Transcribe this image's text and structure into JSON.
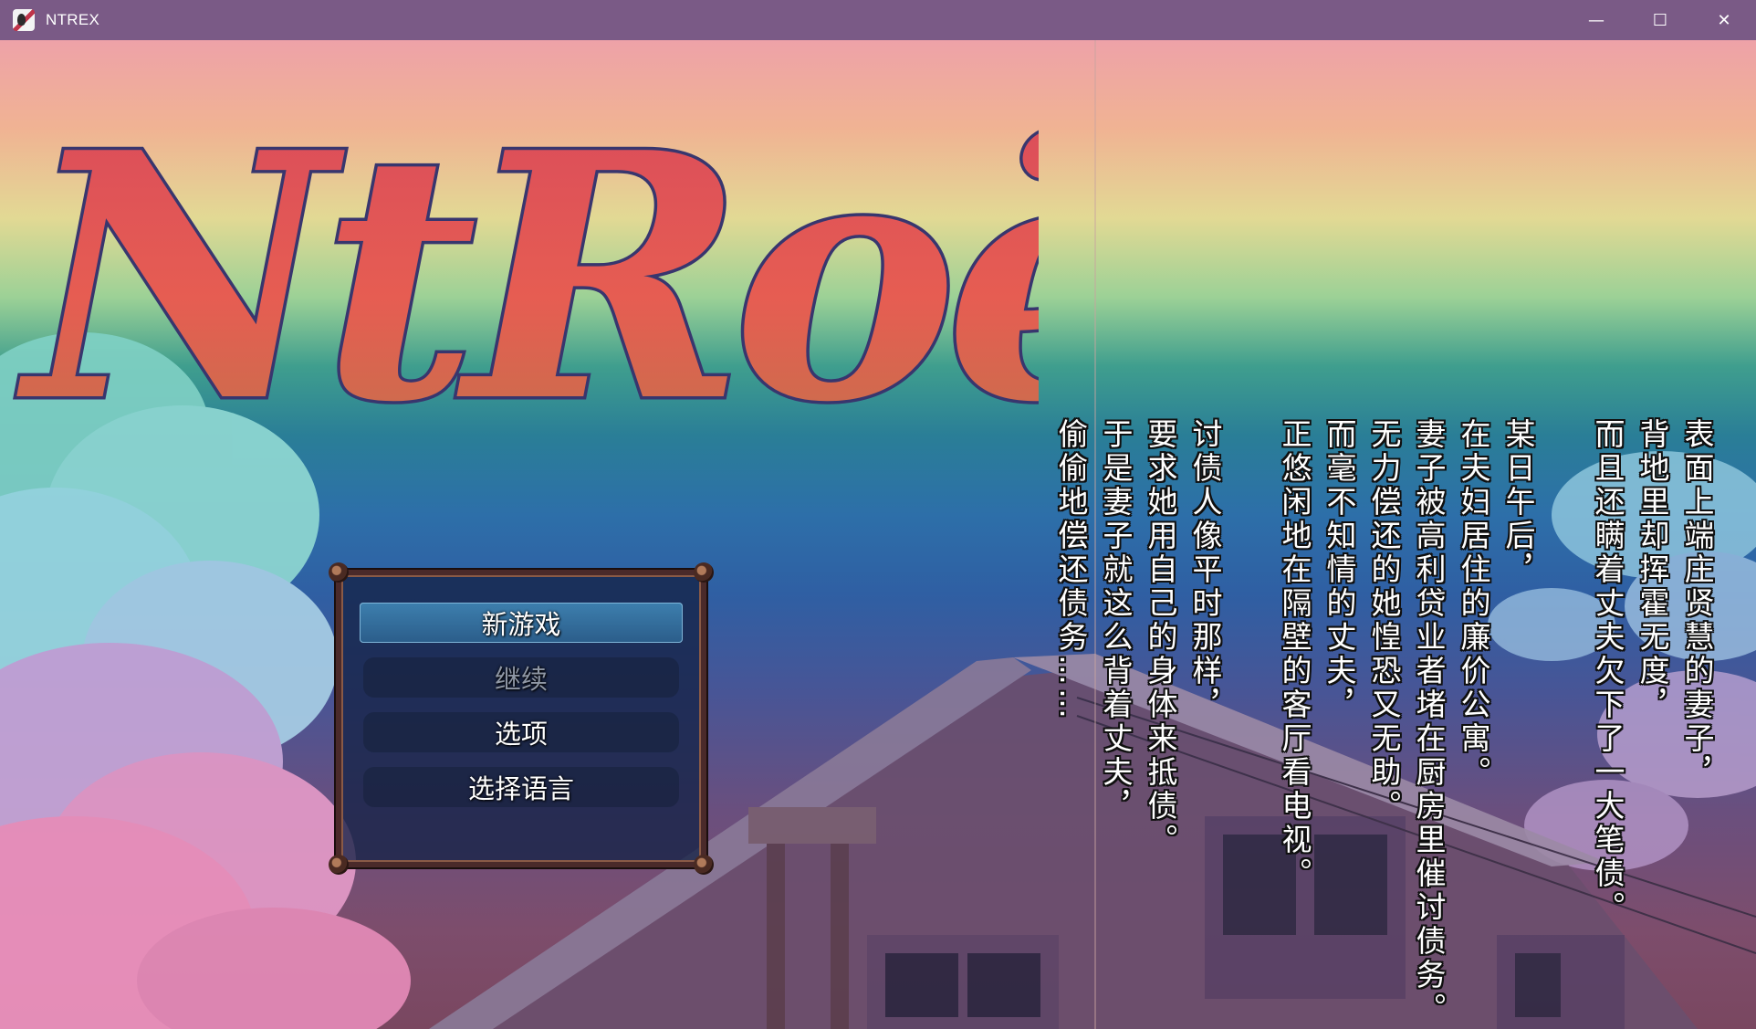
{
  "window": {
    "title": "NTREX",
    "controls": {
      "minimize": "—",
      "maximize": "☐",
      "close": "✕"
    }
  },
  "logo": {
    "text": "NtRoëX"
  },
  "menu": {
    "items": [
      {
        "label": "新游戏",
        "state": "selected"
      },
      {
        "label": "继续",
        "state": "disabled"
      },
      {
        "label": "选项",
        "state": "normal"
      },
      {
        "label": "选择语言",
        "state": "normal"
      }
    ]
  },
  "story": {
    "stanza1": [
      "表面上端庄贤慧的妻子，",
      "背地里却挥霍无度，",
      "而且还瞒着丈夫欠下了一大笔债。"
    ],
    "stanza2": [
      "某日午后，",
      "在夫妇居住的廉价公寓。",
      "妻子被高利贷业者堵在厨房里催讨债务。",
      "无力偿还的她惶恐又无助。",
      "而毫不知情的丈夫，",
      "正悠闲地在隔壁的客厅看电视。"
    ],
    "stanza3": [
      "讨债人像平时那样，",
      "要求她用自己的身体来抵债。",
      "于是妻子就这么背着丈夫，",
      "偷偷地偿还债务……"
    ]
  },
  "colors": {
    "titlebar": "#7a5a86",
    "logo_fill": "#e2505e",
    "logo_outline": "#3a3a78",
    "menu_frame": "#4a2a2a",
    "menu_selected": "#3d7fae",
    "text_disabled": "#8f97a5"
  }
}
